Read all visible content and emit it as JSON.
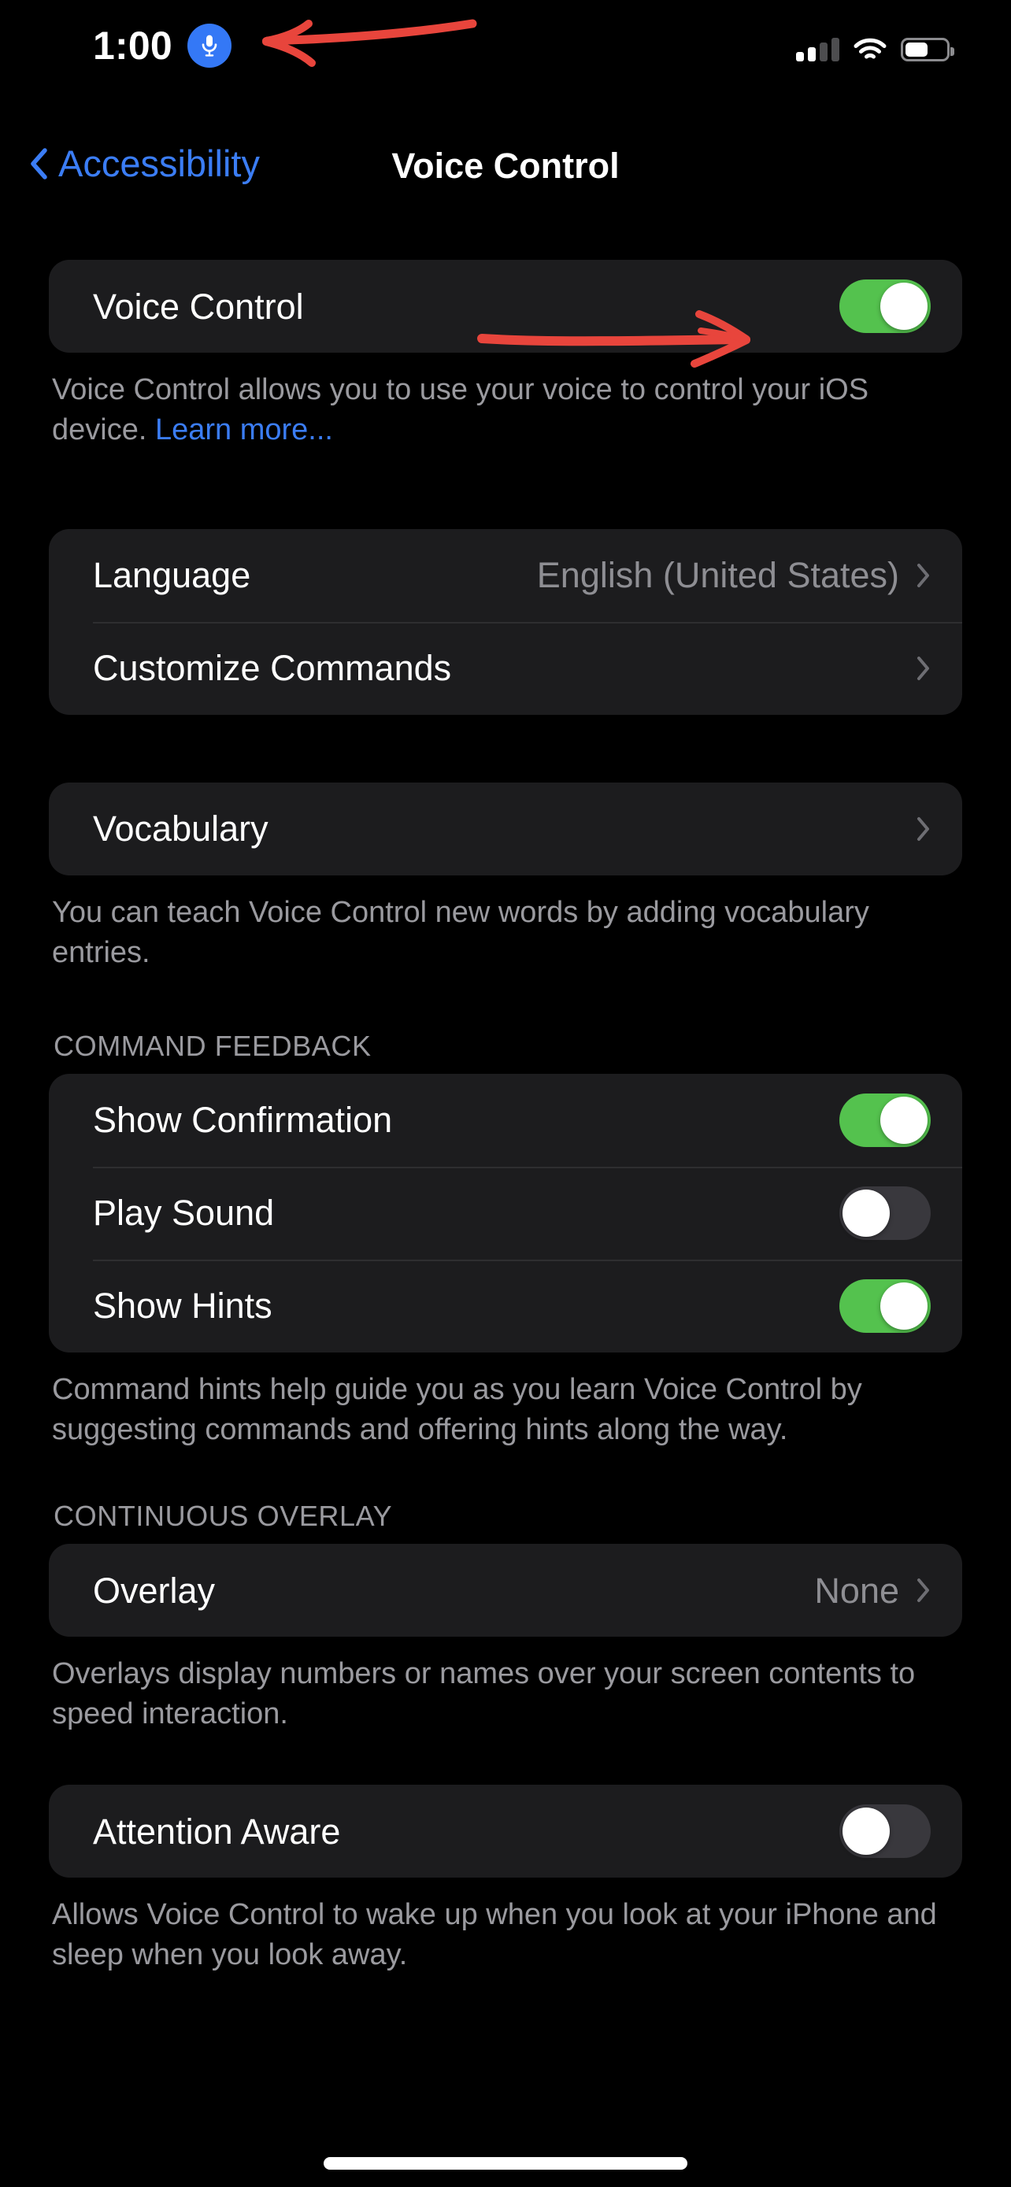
{
  "status_bar": {
    "time": "1:00",
    "mic_icon": "microphone-icon",
    "cellular_icon": "cellular-signal-icon",
    "cellular_bars_active": 2,
    "cellular_bars_total": 4,
    "wifi_icon": "wifi-icon",
    "battery_icon": "battery-icon",
    "battery_percent": 55,
    "accent_blue": "#3478F6"
  },
  "nav": {
    "back_label": "Accessibility",
    "back_icon": "chevron-left-icon",
    "title": "Voice Control",
    "tint": "#3B7DF5"
  },
  "sections": {
    "voice_control": {
      "row_label": "Voice Control",
      "toggle_state": "on",
      "footer": "Voice Control allows you to use your voice to control your iOS device. ",
      "footer_link": "Learn more..."
    },
    "language": {
      "rows": [
        {
          "label": "Language",
          "value": "English (United States)",
          "accessory": "chevron-right-icon"
        },
        {
          "label": "Customize Commands",
          "value": "",
          "accessory": "chevron-right-icon"
        }
      ]
    },
    "vocabulary": {
      "row_label": "Vocabulary",
      "accessory": "chevron-right-icon",
      "footer": "You can teach Voice Control new words by adding vocabulary entries."
    },
    "command_feedback": {
      "header": "COMMAND FEEDBACK",
      "rows": [
        {
          "label": "Show Confirmation",
          "toggle_state": "on"
        },
        {
          "label": "Play Sound",
          "toggle_state": "off"
        },
        {
          "label": "Show Hints",
          "toggle_state": "on"
        }
      ],
      "footer": "Command hints help guide you as you learn Voice Control by suggesting commands and offering hints along the way."
    },
    "continuous_overlay": {
      "header": "CONTINUOUS OVERLAY",
      "row_label": "Overlay",
      "row_value": "None",
      "accessory": "chevron-right-icon",
      "footer": "Overlays display numbers or names over your screen contents to speed interaction."
    },
    "attention_aware": {
      "row_label": "Attention Aware",
      "toggle_state": "off",
      "footer": "Allows Voice Control to wake up when you look at your iPhone and sleep when you look away."
    }
  },
  "annotations": {
    "color": "#E8453C",
    "arrow_status_bar": "red-arrow-pointing-left-at-mic-badge",
    "arrow_toggle": "red-arrow-pointing-right-at-voice-control-toggle"
  },
  "colors": {
    "background": "#000000",
    "card": "#1C1C1E",
    "separator": "#2E2E30",
    "secondary_text": "#9A9A9F",
    "value_text": "#8E8E93",
    "toggle_on": "#54C24E",
    "toggle_off": "#39383D"
  },
  "home_indicator": "home-indicator-bar"
}
